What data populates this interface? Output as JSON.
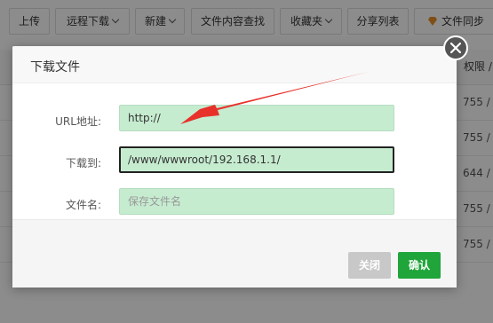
{
  "toolbar": {
    "upload": "上传",
    "remote_download": "远程下载",
    "new": "新建",
    "content_search": "文件内容查找",
    "favorites": "收藏夹",
    "share_list": "分享列表",
    "file_sync": "文件同步"
  },
  "table": {
    "permission_header": "权限 /",
    "permissions": [
      "755 /",
      "755 /",
      "644 /",
      "755 /",
      "755 /"
    ]
  },
  "dialog": {
    "title": "下载文件",
    "url_label": "URL地址:",
    "url_value": "http://",
    "dest_label": "下载到:",
    "dest_value": "/www/wwwroot/192.168.1.1/",
    "filename_label": "文件名:",
    "filename_placeholder": "保存文件名",
    "close_button": "关闭",
    "confirm_button": "确认"
  },
  "colors": {
    "input_bg": "#c6ecd0",
    "confirm": "#20a53a",
    "annotation_arrow": "#e8312a"
  }
}
